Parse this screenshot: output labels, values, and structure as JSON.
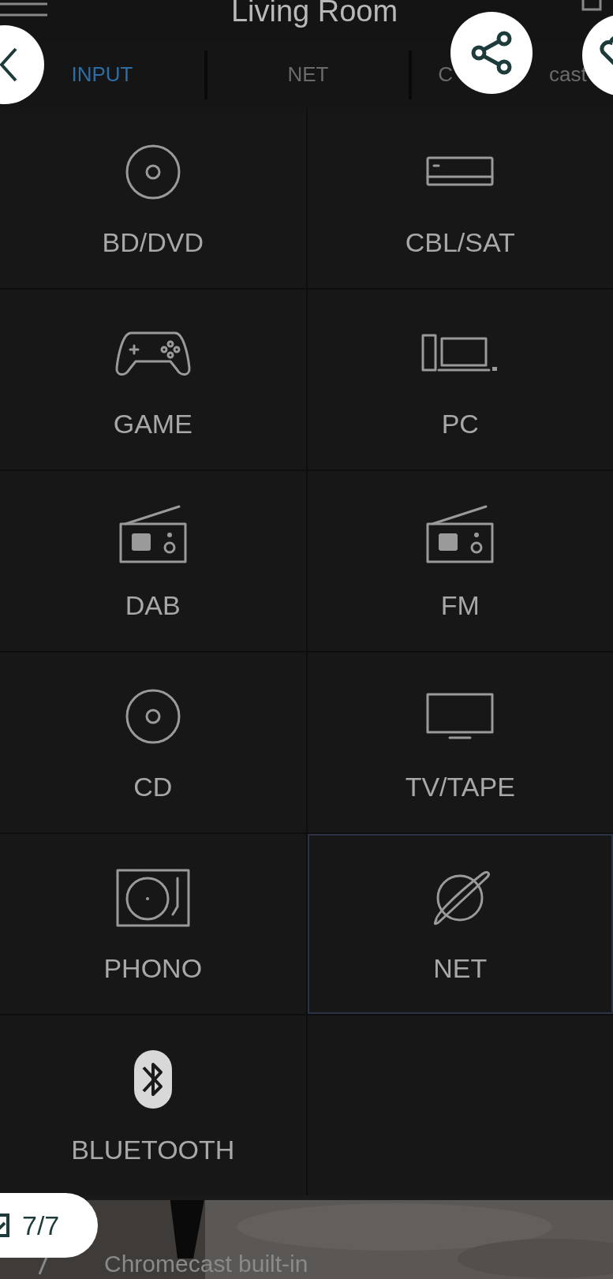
{
  "header": {
    "title": "Living Room"
  },
  "tabs": [
    {
      "label": "INPUT",
      "selected": true
    },
    {
      "label": "NET",
      "selected": false
    },
    {
      "label": "C",
      "hidden_part": "cast",
      "selected": false
    }
  ],
  "inputs": [
    {
      "label": "BD/DVD",
      "kind": "disc",
      "selected": false
    },
    {
      "label": "CBL/SAT",
      "kind": "settop",
      "selected": false
    },
    {
      "label": "GAME",
      "kind": "gamepad",
      "selected": false
    },
    {
      "label": "PC",
      "kind": "pc",
      "selected": false
    },
    {
      "label": "DAB",
      "kind": "radio",
      "selected": false
    },
    {
      "label": "FM",
      "kind": "radio",
      "selected": false
    },
    {
      "label": "CD",
      "kind": "disc",
      "selected": false
    },
    {
      "label": "TV/TAPE",
      "kind": "tv",
      "selected": false
    },
    {
      "label": "PHONO",
      "kind": "turntable",
      "selected": false
    },
    {
      "label": "NET",
      "kind": "planet",
      "selected": true
    },
    {
      "label": "BLUETOOTH",
      "kind": "bluetooth",
      "selected": false
    }
  ],
  "now_playing": {
    "text": "Chromecast built-in"
  },
  "gallery": {
    "counter": "7/7"
  }
}
